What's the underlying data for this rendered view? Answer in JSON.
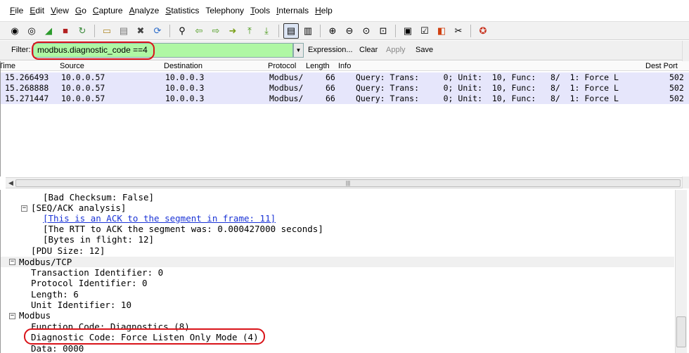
{
  "menu": [
    {
      "u": "F",
      "rest": "ile"
    },
    {
      "u": "E",
      "rest": "dit"
    },
    {
      "u": "V",
      "rest": "iew"
    },
    {
      "u": "G",
      "rest": "o"
    },
    {
      "u": "C",
      "rest": "apture"
    },
    {
      "u": "A",
      "rest": "nalyze"
    },
    {
      "u": "S",
      "rest": "tatistics"
    },
    {
      "u": "",
      "rest": "Telephony"
    },
    {
      "u": "T",
      "rest": "ools"
    },
    {
      "u": "I",
      "rest": "nternals"
    },
    {
      "u": "H",
      "rest": "elp"
    }
  ],
  "toolbar_icons": [
    "interface-list-icon",
    "capture-options-icon",
    "start-capture-icon",
    "stop-capture-icon",
    "restart-capture-icon",
    "open-file-icon",
    "save-file-icon",
    "close-file-icon",
    "reload-icon",
    "find-packet-icon",
    "go-back-icon",
    "go-forward-icon",
    "go-to-packet-icon",
    "go-first-icon",
    "go-last-icon",
    "colorize-icon",
    "autoscroll-icon",
    "zoom-in-icon",
    "zoom-out-icon",
    "normal-size-icon",
    "resize-columns-icon",
    "capture-filters-icon",
    "display-filters-icon",
    "coloring-rules-icon",
    "preferences-icon",
    "help-icon"
  ],
  "filter": {
    "label": "Filter:",
    "value": "modbus.diagnostic_code ==4",
    "expression": "Expression...",
    "clear": "Clear",
    "apply": "Apply",
    "save": "Save",
    "accent": "#aff7a4"
  },
  "columns": {
    "time": "Time",
    "source": "Source",
    "destination": "Destination",
    "protocol": "Protocol",
    "length": "Length",
    "info": "Info",
    "dest_port": "Dest Port"
  },
  "packets": [
    {
      "time": "15.266493",
      "source": "10.0.0.57",
      "destination": "10.0.0.3",
      "protocol": "Modbus/",
      "length": "66",
      "info": "Query: Trans:     0; Unit:  10, Func:   8/  1: Force L",
      "dest_port": "502"
    },
    {
      "time": "15.268888",
      "source": "10.0.0.57",
      "destination": "10.0.0.3",
      "protocol": "Modbus/",
      "length": "66",
      "info": "Query: Trans:     0; Unit:  10, Func:   8/  1: Force L",
      "dest_port": "502"
    },
    {
      "time": "15.271447",
      "source": "10.0.0.57",
      "destination": "10.0.0.3",
      "protocol": "Modbus/",
      "length": "66",
      "info": "Query: Trans:     0; Unit:  10, Func:   8/  1: Force L",
      "dest_port": "502"
    }
  ],
  "details": {
    "bad_checksum": "[Bad Checksum: False]",
    "seq_ack": "[SEQ/ACK analysis]",
    "ack_link": "[This is an ACK to the segment in frame: 11]",
    "rtt": "[The RTT to ACK the segment was: 0.000427000 seconds]",
    "bytes_in_flight": "[Bytes in flight: 12]",
    "pdu_size": "[PDU Size: 12]",
    "modbus_tcp": "Modbus/TCP",
    "transaction_id": "Transaction Identifier: 0",
    "protocol_id": "Protocol Identifier: 0",
    "length": "Length: 6",
    "unit_id": "Unit Identifier: 10",
    "modbus": "Modbus",
    "function_code": "Function Code: Diagnostics (8)",
    "diagnostic_code": "Diagnostic Code: Force Listen Only Mode (4)",
    "data": "Data: 0000"
  },
  "highlight_color": "#d9141a"
}
